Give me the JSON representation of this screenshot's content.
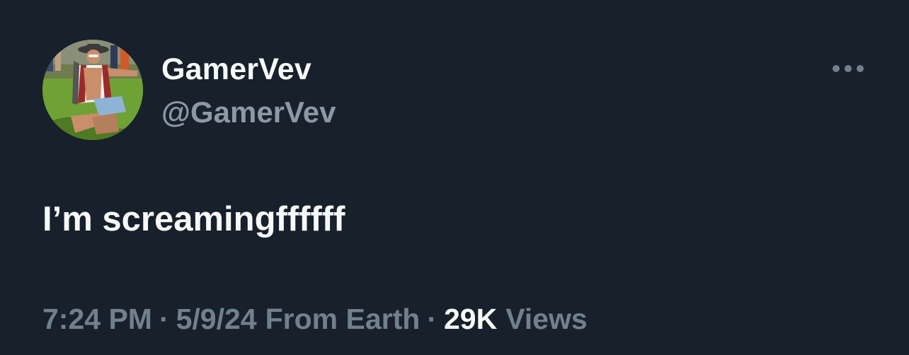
{
  "tweet": {
    "display_name": "GamerVev",
    "handle": "@GamerVev",
    "text": "I’m screamingffffff",
    "time": "7:24 PM",
    "separator": "·",
    "date": "5/9/24",
    "source": "From Earth",
    "views_count": "29K",
    "views_label": "Views"
  },
  "icons": {
    "more": "more-horizontal-icon",
    "avatar": "profile-photo"
  },
  "colors": {
    "background": "#17202b",
    "primary_text": "#f7f9f9",
    "secondary_text": "#8b98a5",
    "meta_text": "#71808d"
  }
}
